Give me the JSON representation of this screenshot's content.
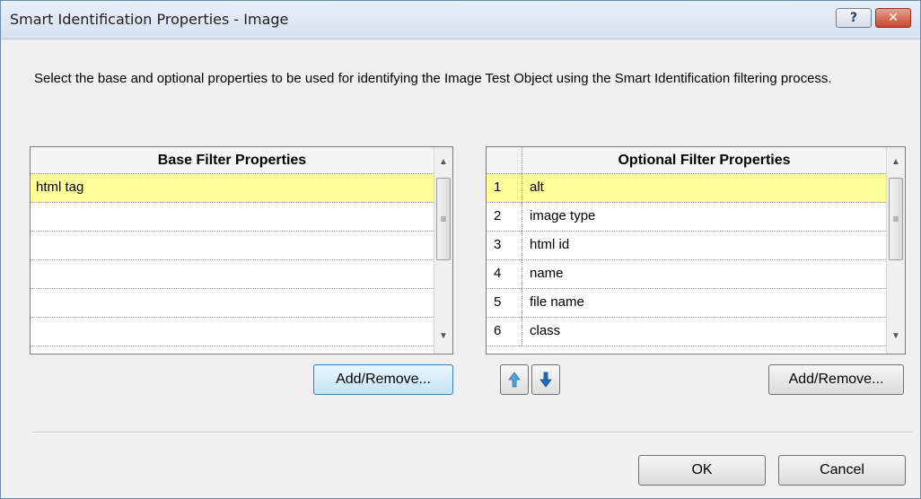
{
  "window": {
    "title": "Smart Identification Properties - Image",
    "help_label": "?",
    "close_label": "✕"
  },
  "instructions": "Select the base and optional properties to be used for identifying the Image Test Object using the Smart Identification filtering process.",
  "base_filter": {
    "header": "Base Filter Properties",
    "rows": [
      "html tag",
      "",
      "",
      "",
      "",
      ""
    ],
    "selected_index": 0,
    "add_remove_label": "Add/Remove..."
  },
  "optional_filter": {
    "header": "Optional Filter Properties",
    "rows": [
      {
        "num": "1",
        "name": "alt"
      },
      {
        "num": "2",
        "name": "image type"
      },
      {
        "num": "3",
        "name": "html id"
      },
      {
        "num": "4",
        "name": "name"
      },
      {
        "num": "5",
        "name": "file name"
      },
      {
        "num": "6",
        "name": "class"
      }
    ],
    "selected_index": 0,
    "add_remove_label": "Add/Remove...",
    "move_up_icon": "up-arrow-icon",
    "move_down_icon": "down-arrow-icon"
  },
  "footer": {
    "ok_label": "OK",
    "cancel_label": "Cancel"
  },
  "colors": {
    "selection": "#ffff99",
    "arrow_up": "#4aa6d9",
    "arrow_down": "#1e6fb8"
  },
  "icons": {
    "scroll_up": "▲",
    "scroll_down": "▼",
    "scroll_grip": "≡"
  }
}
